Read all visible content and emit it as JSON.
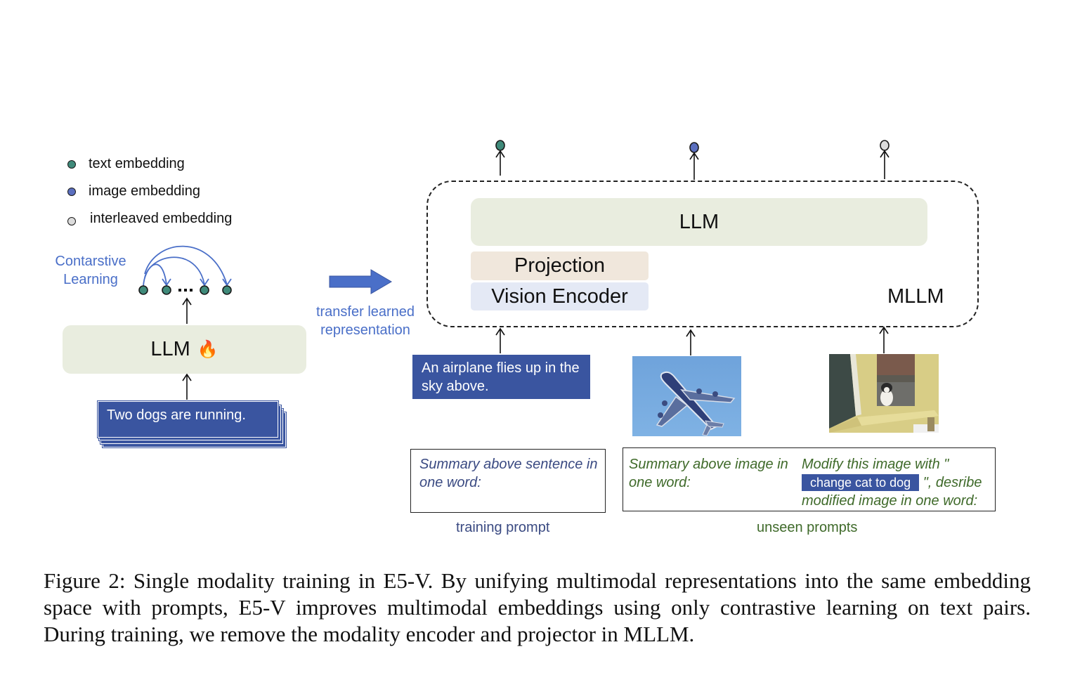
{
  "legend": [
    {
      "label": "text embedding",
      "icon": "text-embedding-dot-icon",
      "color": "#3f8a7a"
    },
    {
      "label": "image embedding",
      "icon": "image-embedding-dot-icon",
      "color": "#5b6fbf"
    },
    {
      "label": "interleaved embedding",
      "icon": "interleaved-embedding-dot-icon",
      "color": "#dcdcdc"
    }
  ],
  "left_panel": {
    "contrastive_label_line1": "Contarstive",
    "contrastive_label_line2": "Learning",
    "ellipsis": "...",
    "llm_label": "LLM",
    "flame_icon": "🔥",
    "input_text": "Two dogs are running."
  },
  "transfer": {
    "line1": "transfer learned",
    "line2": "representation"
  },
  "mllm": {
    "llm_label": "LLM",
    "projection_label": "Projection",
    "vision_encoder_label": "Vision Encoder",
    "mllm_label": "MLLM",
    "text_input": "An airplane flies up in the sky above.",
    "image_inputs": [
      "airplane photo",
      "cat at window photo"
    ]
  },
  "prompts": {
    "training_prompt_text": "Summary above sentence in one word:",
    "training_caption": "training prompt",
    "unseen_prompt_1": "Summary above image in one word:",
    "unseen_prompt_2_pre": "Modify this image with \"",
    "unseen_prompt_2_highlight": "change cat to dog",
    "unseen_prompt_2_post": "\", desribe modified image in one word:",
    "unseen_caption": "unseen prompts"
  },
  "colors": {
    "text_embedding": "#3f8a7a",
    "image_embedding": "#5b6fbf",
    "interleaved_embedding": "#dcdcdc",
    "accent_blue": "#3a55a0",
    "arrow_blue": "#4a6fc8",
    "prompt_green": "#3f6a2a"
  },
  "caption": "Figure 2: Single modality training in E5-V. By unifying multimodal representations into the same embedding space with prompts, E5-V improves multimodal embeddings using only contrastive learning on text pairs. During training, we remove the modality encoder and projector in MLLM."
}
